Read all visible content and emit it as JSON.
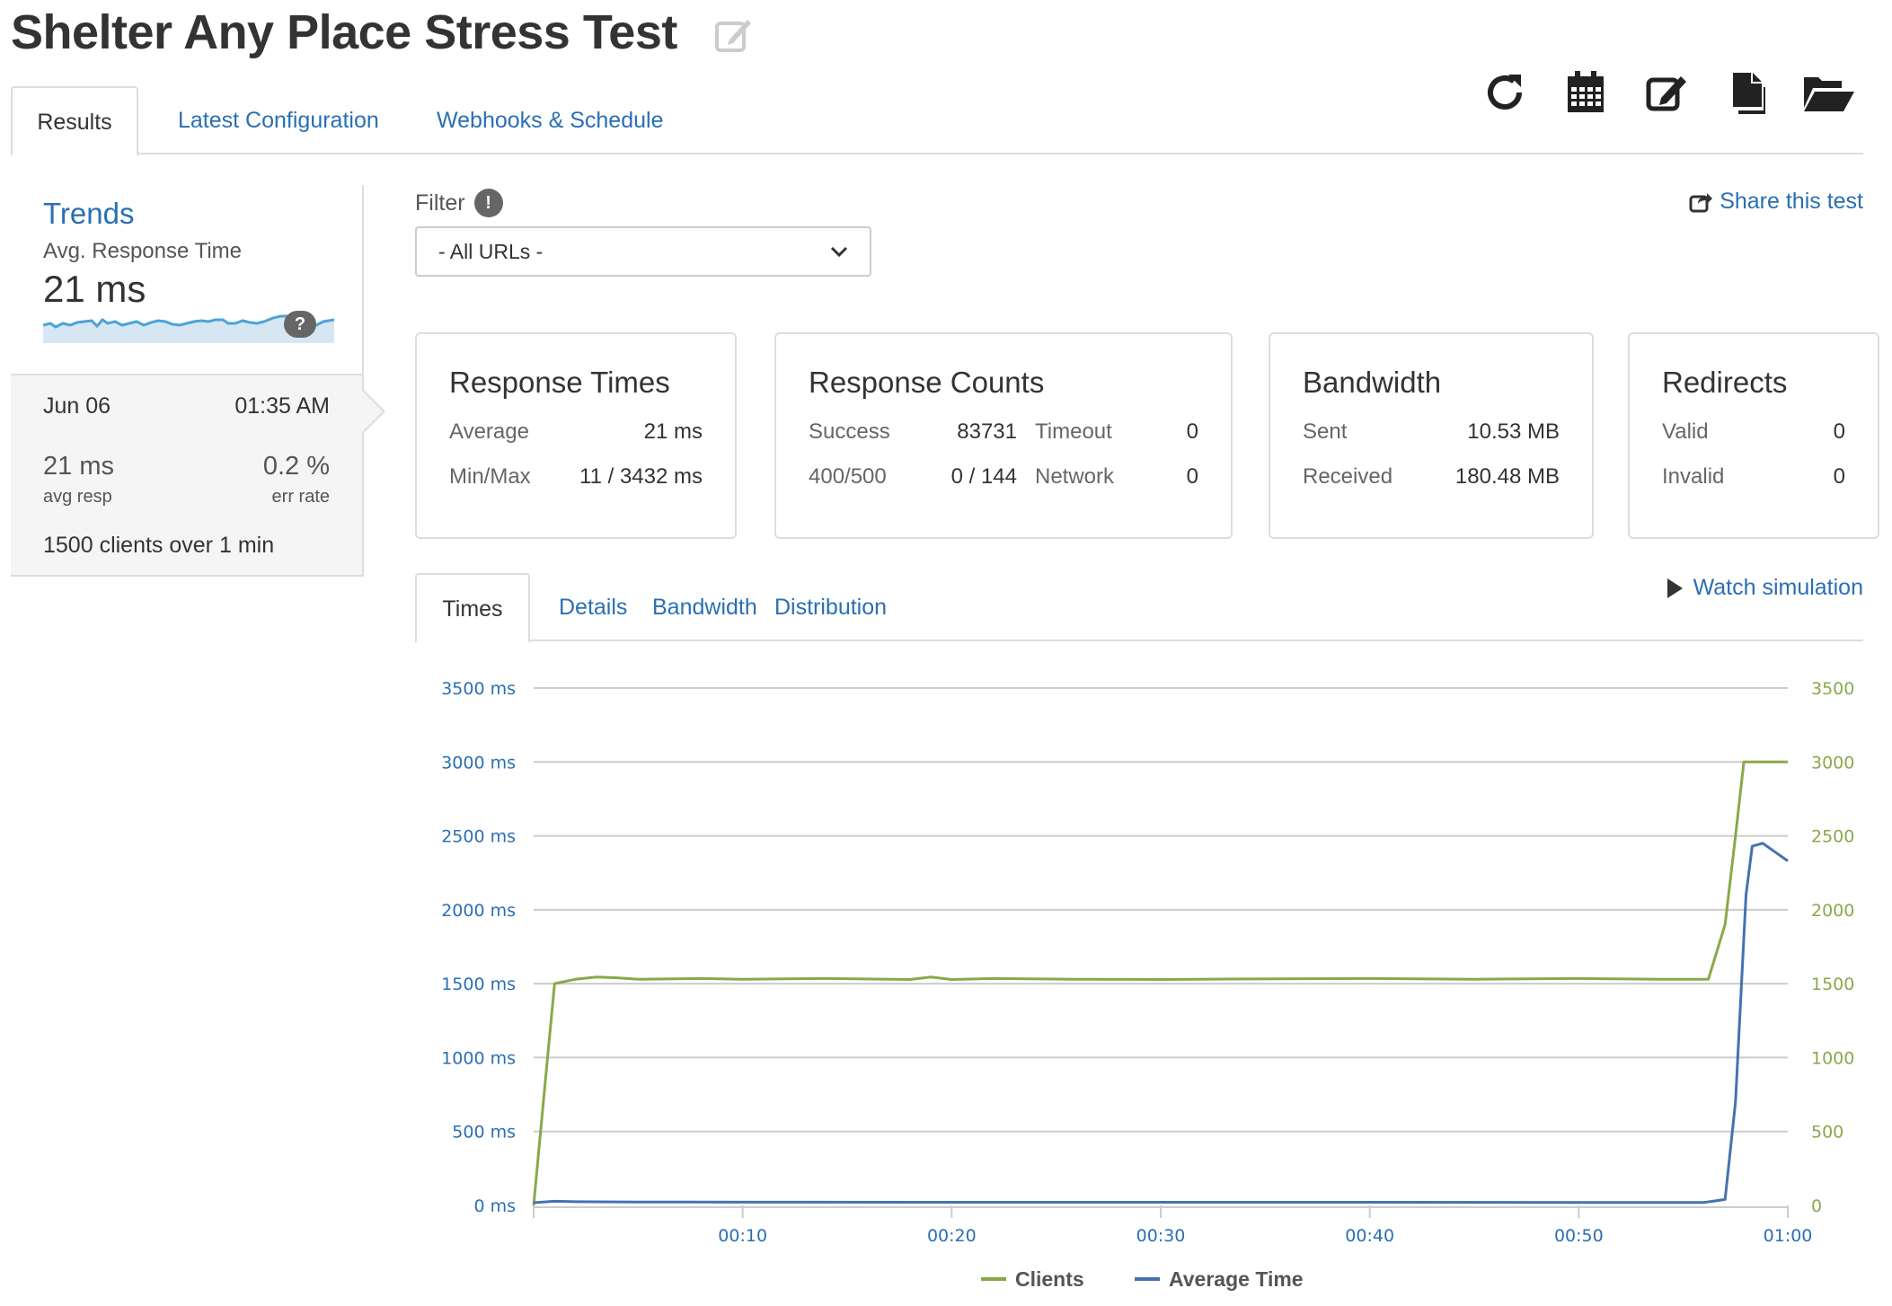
{
  "page": {
    "title": "Shelter Any Place Stress Test"
  },
  "toolbar_icons": [
    "refresh-icon",
    "calendar-icon",
    "edit-icon",
    "copy-icon",
    "folder-open-icon"
  ],
  "main_tabs": [
    {
      "label": "Results",
      "active": true
    },
    {
      "label": "Latest Configuration",
      "active": false
    },
    {
      "label": "Webhooks & Schedule",
      "active": false
    }
  ],
  "sidebar": {
    "trends_title": "Trends",
    "trends_metric": "Avg. Response Time",
    "trends_value": "21 ms",
    "help": "?",
    "run": {
      "date": "Jun 06",
      "time": "01:35 AM",
      "avg_resp_value": "21 ms",
      "avg_resp_label": "avg resp",
      "err_rate_value": "0.2 %",
      "err_rate_label": "err rate",
      "clients_count": "1500",
      "clients_mid": " clients over ",
      "duration_num": "1",
      "duration_unit": " min"
    }
  },
  "filter": {
    "label": "Filter",
    "info": "!",
    "selected": "- All URLs -"
  },
  "share_label": "Share this test",
  "cards": {
    "response_times": {
      "title": "Response Times",
      "average_label": "Average",
      "average_value": "21 ms",
      "minmax_label": "Min/Max",
      "minmax_value": "11 / 3432 ms"
    },
    "response_counts": {
      "title": "Response Counts",
      "success_label": "Success",
      "success_value": "83731",
      "timeout_label": "Timeout",
      "timeout_value": "0",
      "errors_label": "400/500",
      "errors_value": "0 / 144",
      "network_label": "Network",
      "network_value": "0"
    },
    "bandwidth": {
      "title": "Bandwidth",
      "sent_label": "Sent",
      "sent_value": "10.53 MB",
      "received_label": "Received",
      "received_value": "180.48 MB"
    },
    "redirects": {
      "title": "Redirects",
      "valid_label": "Valid",
      "valid_value": "0",
      "invalid_label": "Invalid",
      "invalid_value": "0"
    }
  },
  "sub_tabs": [
    {
      "label": "Times",
      "active": true
    },
    {
      "label": "Details",
      "active": false
    },
    {
      "label": "Bandwidth",
      "active": false
    },
    {
      "label": "Distribution",
      "active": false
    }
  ],
  "watch_label": "Watch simulation",
  "colors": {
    "accent": "#2a6fb4",
    "clients": "#8aa84a",
    "avg_time": "#4472b0"
  },
  "chart_data": {
    "type": "line",
    "y_left_ticks": [
      "0 ms",
      "500 ms",
      "1000 ms",
      "1500 ms",
      "2000 ms",
      "2500 ms",
      "3000 ms",
      "3500 ms"
    ],
    "y_right_ticks": [
      "0",
      "500",
      "1000",
      "1500",
      "2000",
      "2500",
      "3000",
      "3500"
    ],
    "x_ticks": [
      "00:10",
      "00:20",
      "00:30",
      "00:40",
      "00:50",
      "01:00"
    ],
    "ylim": [
      0,
      3500
    ],
    "xlim_seconds": [
      0,
      60
    ],
    "grid": true,
    "legend_position": "bottom-center",
    "series": [
      {
        "name": "Clients",
        "axis": "right",
        "points": [
          [
            0,
            0
          ],
          [
            0.5,
            750
          ],
          [
            1,
            1500
          ],
          [
            2,
            1530
          ],
          [
            3,
            1545
          ],
          [
            4,
            1540
          ],
          [
            5,
            1530
          ],
          [
            8,
            1535
          ],
          [
            10,
            1530
          ],
          [
            14,
            1535
          ],
          [
            18,
            1528
          ],
          [
            19,
            1545
          ],
          [
            20,
            1528
          ],
          [
            22,
            1535
          ],
          [
            26,
            1530
          ],
          [
            30,
            1528
          ],
          [
            34,
            1532
          ],
          [
            40,
            1535
          ],
          [
            45,
            1530
          ],
          [
            50,
            1535
          ],
          [
            54,
            1530
          ],
          [
            56.2,
            1530
          ],
          [
            57,
            1900
          ],
          [
            57.5,
            2500
          ],
          [
            57.9,
            3000
          ],
          [
            60,
            3000
          ]
        ]
      },
      {
        "name": "Average Time",
        "axis": "left",
        "points": [
          [
            0,
            18
          ],
          [
            1,
            28
          ],
          [
            2,
            25
          ],
          [
            5,
            23
          ],
          [
            10,
            22
          ],
          [
            20,
            21
          ],
          [
            30,
            21
          ],
          [
            40,
            21
          ],
          [
            50,
            20
          ],
          [
            56,
            20
          ],
          [
            57,
            40
          ],
          [
            57.5,
            700
          ],
          [
            58,
            2100
          ],
          [
            58.3,
            2430
          ],
          [
            58.8,
            2450
          ],
          [
            59.4,
            2390
          ],
          [
            60,
            2330
          ]
        ]
      }
    ]
  }
}
